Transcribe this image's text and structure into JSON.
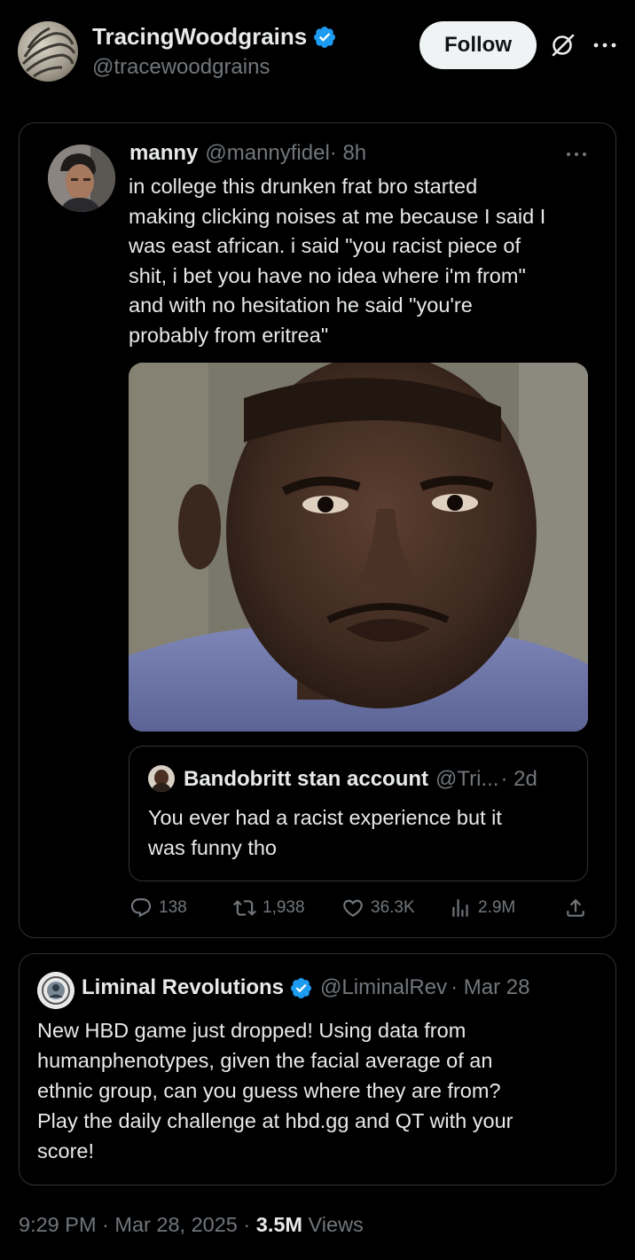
{
  "author": {
    "name": "TracingWoodgrains",
    "handle": "@tracewoodgrains",
    "follow_label": "Follow"
  },
  "quoted_tweet": {
    "name": "manny",
    "handle": "@mannyfidel",
    "time": "· 8h",
    "lines": [
      "in college this drunken frat bro started",
      "making clicking noises at me because I said I",
      "was east african. i said \"you racist piece of",
      "shit, i bet you have no idea where i'm from\"",
      "and with no hesitation he said \"you're",
      "probably from eritrea\""
    ],
    "nested": {
      "name": "Bandobritt stan account",
      "handle": "@Tri...",
      "time": "· 2d",
      "lines": [
        "You ever had a racist experience but it",
        "was funny tho"
      ]
    },
    "stats": {
      "replies": "138",
      "retweets": "1,938",
      "likes": "36.3K",
      "views": "2.9M"
    }
  },
  "liminal_tweet": {
    "name": "Liminal Revolutions",
    "handle": "@LiminalRev",
    "date": "· Mar 28",
    "lines": [
      "New HBD game just dropped! Using data from",
      "humanphenotypes, given the facial average of an",
      "ethnic group, can you guess where they are from?",
      "Play the daily challenge at hbd.gg and QT with your",
      "score!"
    ]
  },
  "footer": {
    "timestamp": "9:29 PM · Mar 28, 2025 ·",
    "views_count": "3.5M",
    "views_label": "Views"
  },
  "colors": {
    "background": "#000000",
    "text_primary": "#e7e9ea",
    "text_secondary": "#71767b",
    "border": "#2f3336",
    "verified_blue": "#1d9bf0",
    "follow_bg": "#eff3f4"
  },
  "icons": {
    "verified": "verified-badge-icon",
    "grok": "grok-icon",
    "more": "more-icon",
    "reply": "reply-icon",
    "retweet": "retweet-icon",
    "like": "like-icon",
    "views": "views-icon",
    "share": "share-icon"
  }
}
